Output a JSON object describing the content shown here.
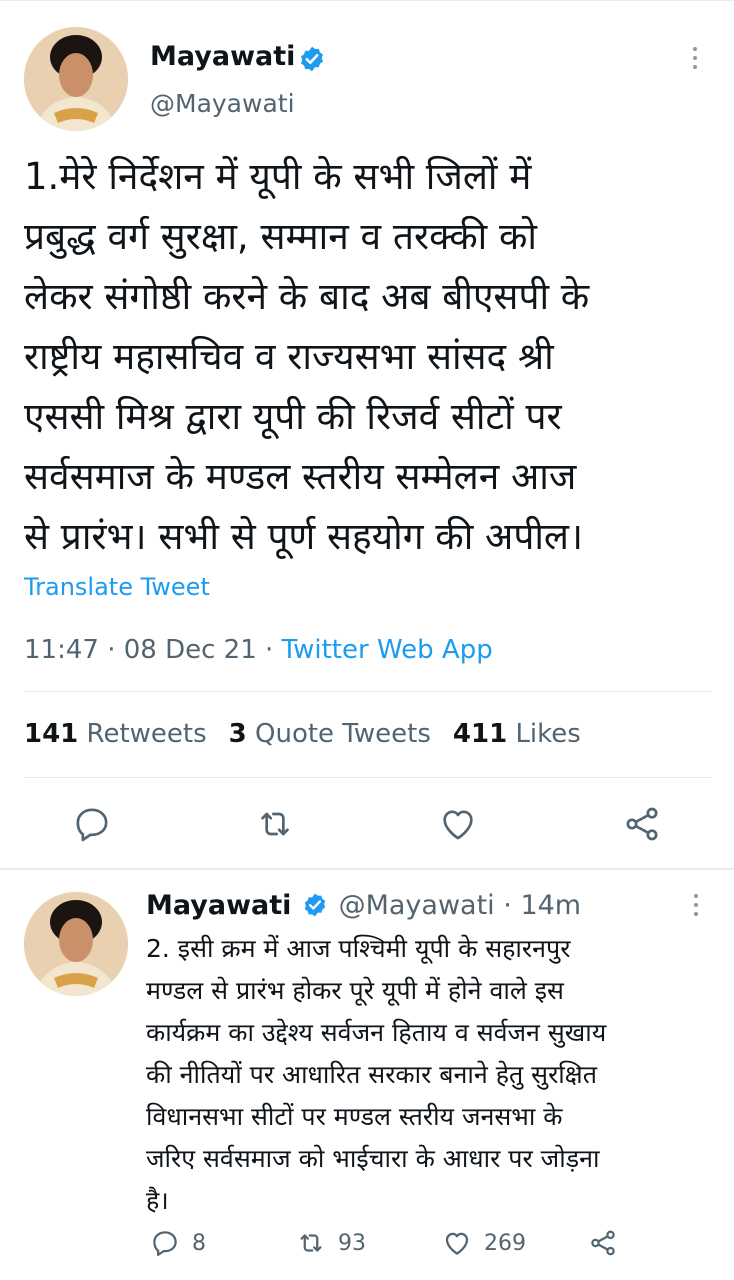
{
  "main_tweet": {
    "name": "Mayawati",
    "handle": "@Mayawati",
    "text": "1.मेरे निर्देशन में यूपी के सभी जिलों में\nप्रबुद्ध वर्ग सुरक्षा, सम्मान व तरक्की को\nलेकर संगोष्ठी करने के बाद अब बीएसपी के\nराष्ट्रीय महासचिव व राज्यसभा सांसद श्री\nएससी मिश्र द्वारा यूपी की रिजर्व सीटों पर\nसर्वसमाज के मण्डल स्तरीय सम्मेलन आज\nसे प्रारंभ। सभी से पूर्ण सहयोग की अपील।",
    "translate_label": "Translate Tweet",
    "time": "11:47",
    "date": "08 Dec 21",
    "source": "Twitter Web App",
    "stats": {
      "retweets_count": "141",
      "retweets_label": "Retweets",
      "quotes_count": "3",
      "quotes_label": "Quote Tweets",
      "likes_count": "411",
      "likes_label": "Likes"
    },
    "icons": [
      "reply-icon",
      "retweet-icon",
      "like-icon",
      "share-icon"
    ]
  },
  "reply_tweet": {
    "name": "Mayawati",
    "handle": "@Mayawati",
    "time_ago": "14m",
    "text": "2. इसी क्रम में आज पश्चिमी यूपी के सहारनपुर\nमण्डल से प्रारंभ होकर पूरे यूपी में होने वाले इस\nकार्यक्रम का उद्देश्य सर्वजन हिताय व सर्वजन सुखाय\nकी नीतियों पर आधारित सरकार बनाने हेतु सुरक्षित\nविधानसभा सीटों पर मण्डल स्तरीय जनसभा के\nजरिए सर्वसमाज को भाईचारा के आधार पर जोड़ना\nहै।",
    "reply_count": "8",
    "retweet_count": "93",
    "like_count": "269"
  },
  "separator": " · ",
  "colors": {
    "accent": "#1d9bf0",
    "text_primary": "#0f1419",
    "text_secondary": "#536471",
    "divider": "#e6ecf0"
  }
}
